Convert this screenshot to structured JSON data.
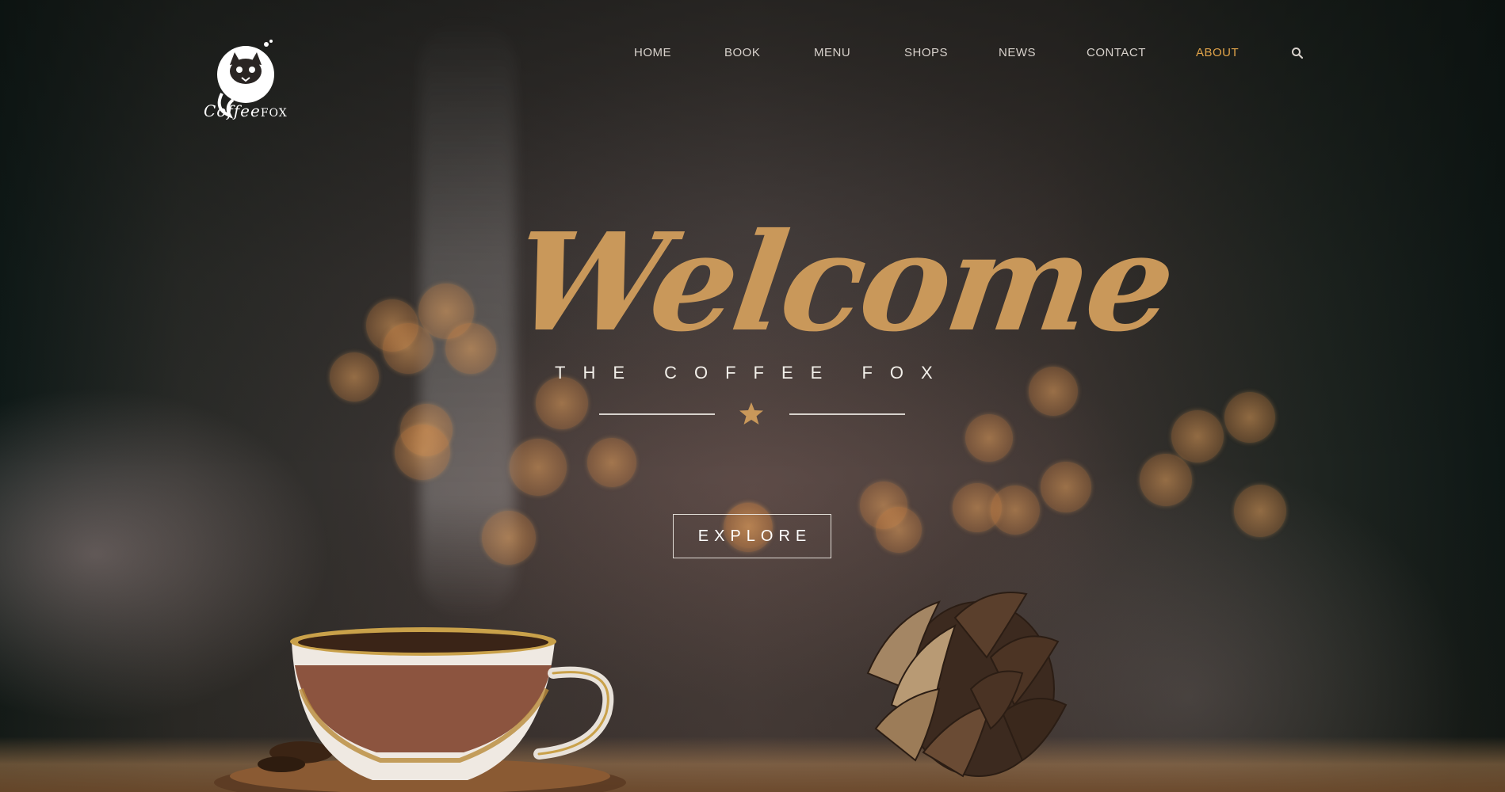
{
  "brand": {
    "logo_main": "Coffee",
    "logo_suffix": "FOX"
  },
  "nav": {
    "items": [
      {
        "label": "HOME",
        "active": false
      },
      {
        "label": "BOOK",
        "active": false
      },
      {
        "label": "MENU",
        "active": false
      },
      {
        "label": "SHOPS",
        "active": false
      },
      {
        "label": "NEWS",
        "active": false
      },
      {
        "label": "CONTACT",
        "active": false
      },
      {
        "label": "ABOUT",
        "active": true
      }
    ],
    "search_icon": "search-icon"
  },
  "hero": {
    "headline": "Welcome",
    "subtitle": "THE COFFEE FOX",
    "divider_icon": "star-icon",
    "cta_label": "EXPLORE"
  },
  "colors": {
    "accent": "#e1a44a",
    "headline": "#c9985a",
    "nav_text": "#d8d2cc",
    "white": "#ffffff"
  }
}
